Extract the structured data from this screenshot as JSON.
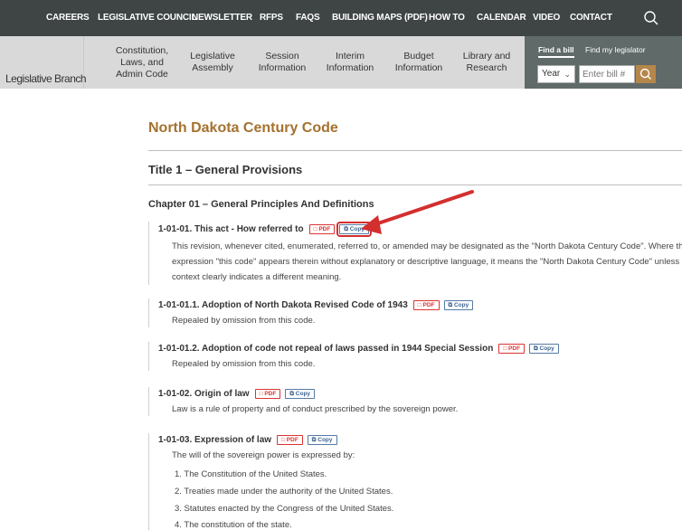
{
  "topnav": {
    "items": [
      "CAREERS",
      "LEGISLATIVE COUNCIL",
      "NEWSLETTER",
      "RFPS",
      "FAQS",
      "BUILDING MAPS (PDF)",
      "HOW TO",
      "CALENDAR",
      "VIDEO",
      "CONTACT"
    ],
    "search_icon": "search-icon",
    "background": "#3f4545"
  },
  "header": {
    "brand": "Legislative Branch",
    "menu": [
      {
        "line1": "Constitution,",
        "line2": "Laws, and",
        "line3": "Admin Code"
      },
      {
        "line1": "Legislative",
        "line2": "Assembly",
        "line3": ""
      },
      {
        "line1": "Session",
        "line2": "Information",
        "line3": ""
      },
      {
        "line1": "Interim",
        "line2": "Information",
        "line3": ""
      },
      {
        "line1": "Budget",
        "line2": "Information",
        "line3": ""
      },
      {
        "line1": "Library and",
        "line2": "Research",
        "line3": ""
      }
    ],
    "find": {
      "tab_active": "Find a bill",
      "tab_other": "Find my legislator",
      "year_label": "Year",
      "bill_placeholder": "Enter bill #",
      "accent": "#b5874a"
    }
  },
  "main": {
    "page_title": "North Dakota Century Code",
    "title_line": "Title 1 – General Provisions",
    "chapter": "Chapter 01 – General Principles And Definitions",
    "pdf_label": "PDF",
    "copy_label": "Copy",
    "sections": [
      {
        "heading": "1-01-01. This act - How referred to",
        "lines": [
          "This revision, whenever cited, enumerated, referred to, or amended may be designated as the \"North Dakota Century Code\". Where the",
          "expression \"this code\" appears therein without explanatory or descriptive language, it means the \"North Dakota Century Code\" unless th",
          "context clearly indicates a different meaning."
        ]
      },
      {
        "heading": "1-01-01.1. Adoption of North Dakota Revised Code of 1943",
        "lines": [
          "Repealed by omission from this code."
        ]
      },
      {
        "heading": "1-01-01.2. Adoption of code not repeal of laws passed in 1944 Special Session",
        "lines": [
          "Repealed by omission from this code."
        ]
      },
      {
        "heading": "1-01-02. Origin of law",
        "lines": [
          "Law is a rule of property and of conduct prescribed by the sovereign power."
        ]
      },
      {
        "heading": "1-01-03. Expression of law",
        "lines": [
          "The will of the sovereign power is expressed by:"
        ],
        "list": [
          "1. The Constitution of the United States.",
          "2. Treaties made under the authority of the United States.",
          "3. Statutes enacted by the Congress of the United States.",
          "4. The constitution of the state."
        ]
      }
    ]
  },
  "colors": {
    "title_accent": "#a5712f",
    "pdf": "#dd3333",
    "copy": "#3d6391",
    "annotation": "#d32f2f"
  }
}
